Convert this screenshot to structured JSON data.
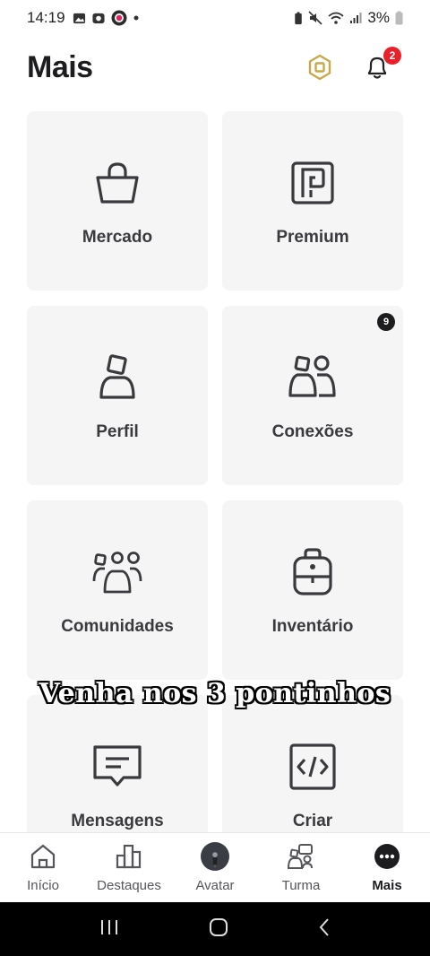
{
  "status_bar": {
    "time": "14:19",
    "battery": "3%"
  },
  "header": {
    "title": "Mais",
    "notification_count": "2"
  },
  "tiles": [
    {
      "label": "Mercado",
      "icon": "shopping-bag-icon"
    },
    {
      "label": "Premium",
      "icon": "premium-icon"
    },
    {
      "label": "Perfil",
      "icon": "profile-icon"
    },
    {
      "label": "Conexões",
      "icon": "connections-icon",
      "badge": "9"
    },
    {
      "label": "Comunidades",
      "icon": "communities-icon"
    },
    {
      "label": "Inventário",
      "icon": "backpack-icon"
    },
    {
      "label": "Mensagens",
      "icon": "message-icon"
    },
    {
      "label": "Criar",
      "icon": "code-icon"
    }
  ],
  "overlay_caption": "Venha nos 3 pontinhos",
  "bottom_nav": [
    {
      "label": "Início",
      "icon": "home-icon"
    },
    {
      "label": "Destaques",
      "icon": "charts-icon"
    },
    {
      "label": "Avatar",
      "icon": "avatar-icon"
    },
    {
      "label": "Turma",
      "icon": "party-icon"
    },
    {
      "label": "Mais",
      "icon": "more-icon",
      "active": true
    }
  ],
  "colors": {
    "accent": "#1d1d1f",
    "badge_red": "#e8202a",
    "tile_bg": "#f5f5f6",
    "robux_gold": "#c7a84a"
  }
}
